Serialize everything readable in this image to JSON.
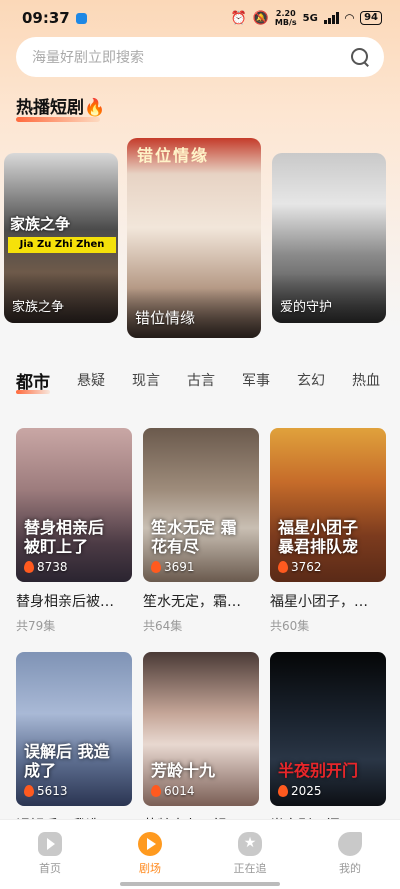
{
  "status": {
    "time": "09:37",
    "speed_value": "2.20",
    "speed_unit": "MB/s",
    "network": "5G",
    "battery": "94"
  },
  "search": {
    "placeholder": "海量好剧立即搜索"
  },
  "hot_section": {
    "title": "热播短剧🔥"
  },
  "carousel": [
    {
      "name": "家族之争",
      "banner_title": "家族之争",
      "banner_sub": "Jia Zu Zhi Zhen"
    },
    {
      "name": "错位情缘",
      "top_text": "错位情缘"
    },
    {
      "name": "爱的守护"
    }
  ],
  "tabs": [
    "都市",
    "悬疑",
    "现言",
    "古言",
    "军事",
    "玄幻",
    "热血"
  ],
  "active_tab": "都市",
  "dramas": [
    {
      "name": "替身相亲后被…",
      "heat": "8738",
      "episodes": "共79集",
      "art_title": "替身相亲后 被盯上了"
    },
    {
      "name": "笙水无定，霜…",
      "heat": "3691",
      "episodes": "共64集",
      "art_title": "笙水无定 霜花有尽"
    },
    {
      "name": "福星小团子，…",
      "heat": "3762",
      "episodes": "共60集",
      "art_title": "福星小团子 暴君排队宠"
    },
    {
      "name": "误解后，我造…",
      "heat": "5613",
      "episodes": "",
      "art_title": "误解后 我造成了"
    },
    {
      "name": "芳龄十九，祖…",
      "heat": "6014",
      "episodes": "",
      "art_title": "芳龄十九"
    },
    {
      "name": "半夜别开门",
      "heat": "2025",
      "episodes": "",
      "art_title": "半夜别开门"
    }
  ],
  "bottom_nav": [
    {
      "label": "首页",
      "icon": "play-icon"
    },
    {
      "label": "剧场",
      "icon": "theater-icon"
    },
    {
      "label": "正在追",
      "icon": "star-icon"
    },
    {
      "label": "我的",
      "icon": "leaf-icon"
    }
  ],
  "colors": {
    "accent": "#ff8a1f",
    "tab_underline": "#ff6a3d"
  }
}
